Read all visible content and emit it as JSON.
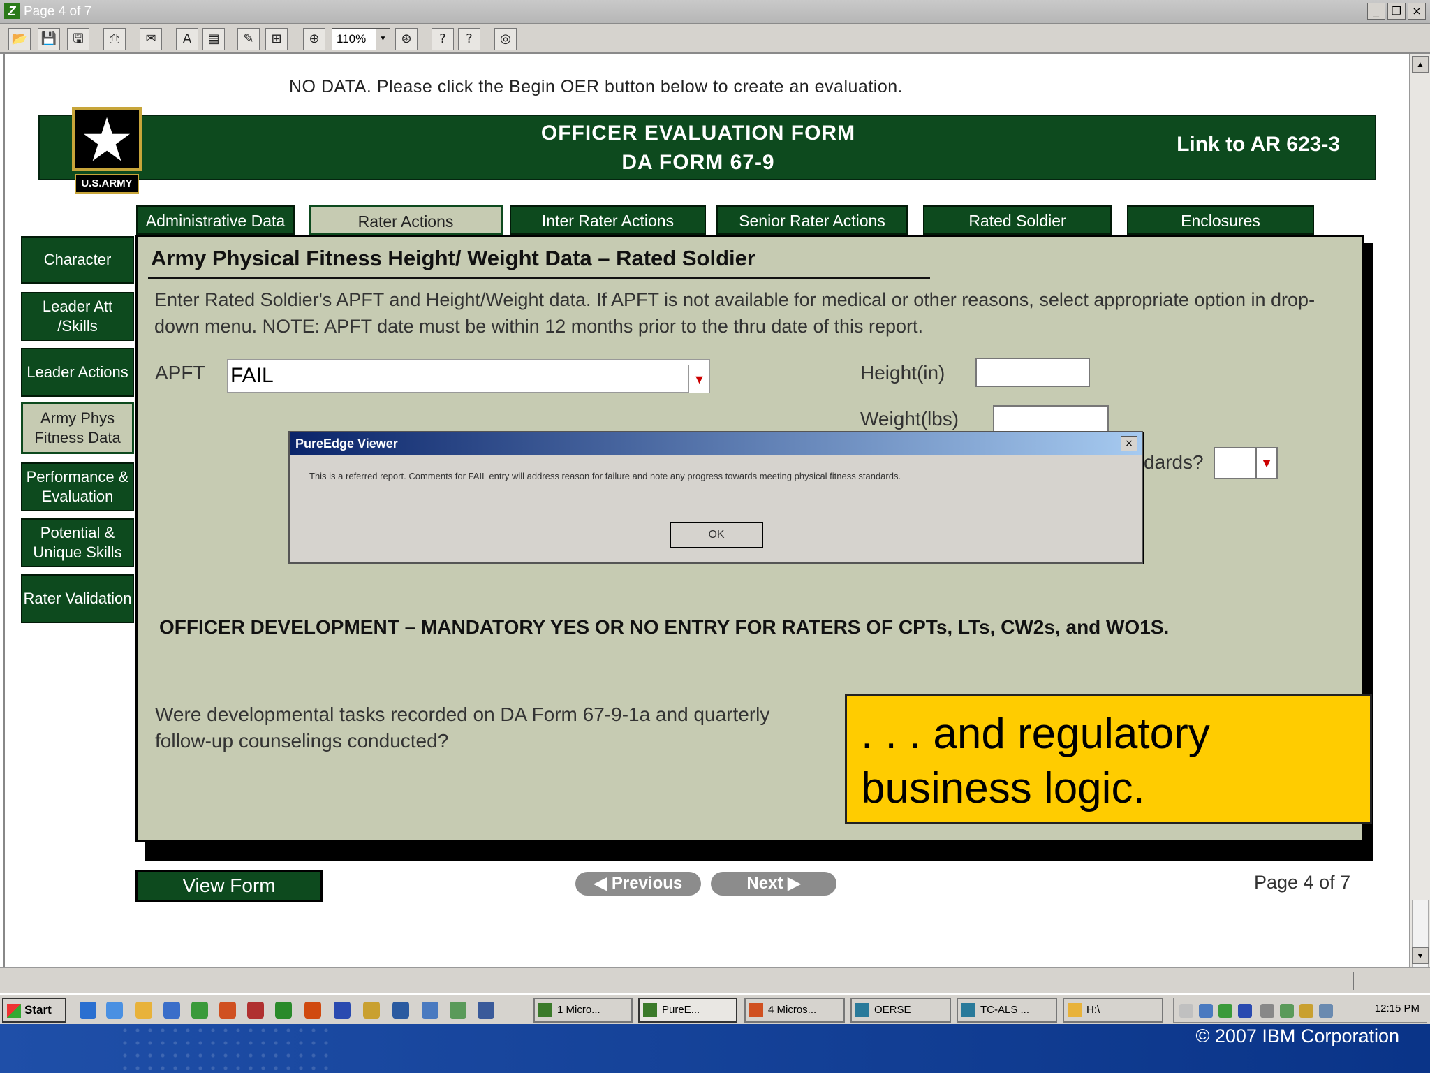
{
  "window": {
    "title": "Page 4 of 7",
    "controls": {
      "minimize": "_",
      "restore": "❐",
      "close": "×"
    }
  },
  "toolbar": {
    "zoom": "110%"
  },
  "notice": "NO DATA. Please click the Begin OER button below to create an evaluation.",
  "header": {
    "title_line1": "OFFICER EVALUATION FORM",
    "title_line2": "DA FORM 67-9",
    "link": "Link to AR 623-3",
    "logo_label": "U.S.ARMY"
  },
  "tabs": [
    {
      "label": "Administrative Data"
    },
    {
      "label": "Rater Actions"
    },
    {
      "label": "Inter Rater Actions"
    },
    {
      "label": "Senior Rater Actions"
    },
    {
      "label": "Rated Soldier"
    },
    {
      "label": "Enclosures"
    }
  ],
  "sidenav": [
    {
      "label": "Character"
    },
    {
      "label": "Leader Att /Skills"
    },
    {
      "label": "Leader Actions"
    },
    {
      "label": "Army Phys Fitness Data"
    },
    {
      "label": "Performance & Evaluation"
    },
    {
      "label": "Potential & Unique Skills"
    },
    {
      "label": "Rater Validation"
    }
  ],
  "section": {
    "title": "Army Physical Fitness  Height/ Weight Data  – Rated Soldier",
    "instructions": "Enter Rated Soldier's APFT and Height/Weight data.   If APFT is not available for medical or other reasons, select appropriate option in drop-down menu.  NOTE:  APFT date must be within 12 months prior to the thru date of this report.",
    "apft_label": "APFT",
    "apft_value": "FAIL",
    "height_label": "Height(in)",
    "weight_label": "Weight(lbs)",
    "standards_label": "dards?"
  },
  "dialog": {
    "title": "PureEdge Viewer",
    "message": "This is a referred report. Comments for FAIL entry will address reason for failure and note any progress towards meeting physical fitness standards.",
    "ok": "OK",
    "close": "×"
  },
  "officer_development": {
    "title": "OFFICER DEVELOPMENT – MANDATORY YES OR NO ENTRY FOR RATERS OF CPTs, LTs, CW2s, and WO1S.",
    "question": "Were developmental tasks recorded on DA Form 67-9-1a and quarterly follow-up counselings conducted?"
  },
  "callout": {
    "text": ". . . and regulatory business logic."
  },
  "bottom_nav": {
    "view_form": "View Form",
    "previous": "◀  Previous",
    "next": "Next  ▶",
    "page": "Page 4 of 7"
  },
  "taskbar": {
    "start": "Start",
    "items": [
      {
        "label": "1 Micro..."
      },
      {
        "label": "PureE..."
      },
      {
        "label": "4 Micros..."
      },
      {
        "label": "OERSE"
      },
      {
        "label": "TC-ALS ..."
      },
      {
        "label": "H:\\"
      }
    ],
    "clock": "12:15 PM"
  },
  "footer": {
    "copyright": "© 2007 IBM Corporation"
  },
  "colors": {
    "army_green": "#0d4a1e",
    "panel": "#c6cbb2",
    "callout": "#ffcc00",
    "footer_blue": "#1f4fa8"
  }
}
